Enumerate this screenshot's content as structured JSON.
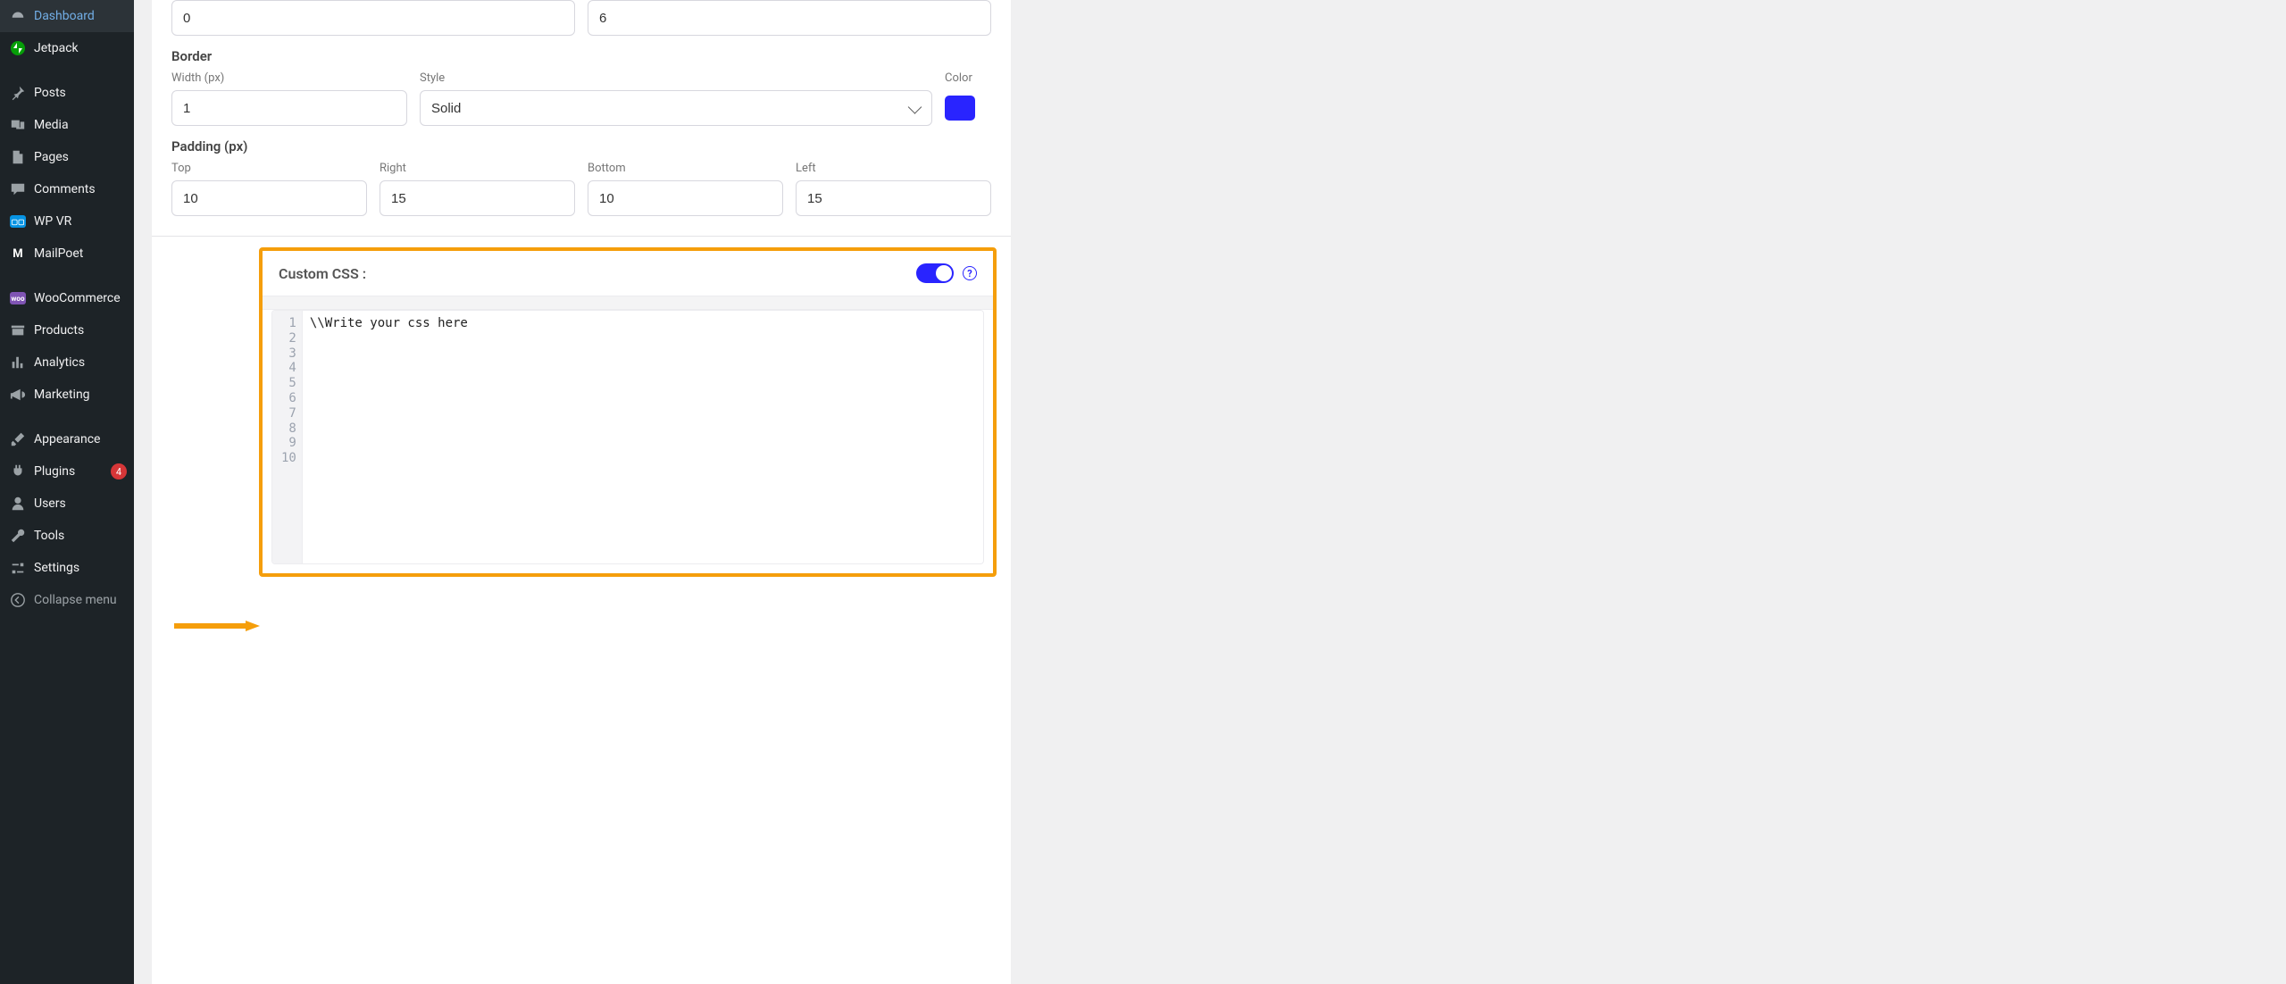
{
  "sidebar": {
    "items": [
      {
        "label": "Dashboard",
        "icon": "dashboard"
      },
      {
        "label": "Jetpack",
        "icon": "jetpack"
      },
      {
        "gap": true
      },
      {
        "label": "Posts",
        "icon": "pin"
      },
      {
        "label": "Media",
        "icon": "media"
      },
      {
        "label": "Pages",
        "icon": "pages"
      },
      {
        "label": "Comments",
        "icon": "comments"
      },
      {
        "label": "WP VR",
        "icon": "wpvr"
      },
      {
        "label": "MailPoet",
        "icon": "mailpoet"
      },
      {
        "gap": true
      },
      {
        "label": "WooCommerce",
        "icon": "woo"
      },
      {
        "label": "Products",
        "icon": "products"
      },
      {
        "label": "Analytics",
        "icon": "analytics"
      },
      {
        "label": "Marketing",
        "icon": "marketing"
      },
      {
        "gap": true
      },
      {
        "label": "Appearance",
        "icon": "appearance"
      },
      {
        "label": "Plugins",
        "icon": "plugins",
        "badge": "4"
      },
      {
        "label": "Users",
        "icon": "users"
      },
      {
        "label": "Tools",
        "icon": "tools"
      },
      {
        "label": "Settings",
        "icon": "settings"
      },
      {
        "label": "Collapse menu",
        "icon": "collapse",
        "collapse": true
      }
    ]
  },
  "form": {
    "top_row": {
      "left": "0",
      "right": "6"
    },
    "border": {
      "section": "Border",
      "width_label": "Width (px)",
      "width": "1",
      "style_label": "Style",
      "style": "Solid",
      "color_label": "Color",
      "color": "#2924ff"
    },
    "padding": {
      "section": "Padding (px)",
      "top_label": "Top",
      "top": "10",
      "right_label": "Right",
      "right": "15",
      "bottom_label": "Bottom",
      "bottom": "10",
      "left_label": "Left",
      "left": "15"
    }
  },
  "custom_css": {
    "title": "Custom CSS :",
    "enabled": true,
    "line_numbers": "1\n2\n3\n4\n5\n6\n7\n8\n9\n10",
    "code": "\\\\Write your css here"
  }
}
